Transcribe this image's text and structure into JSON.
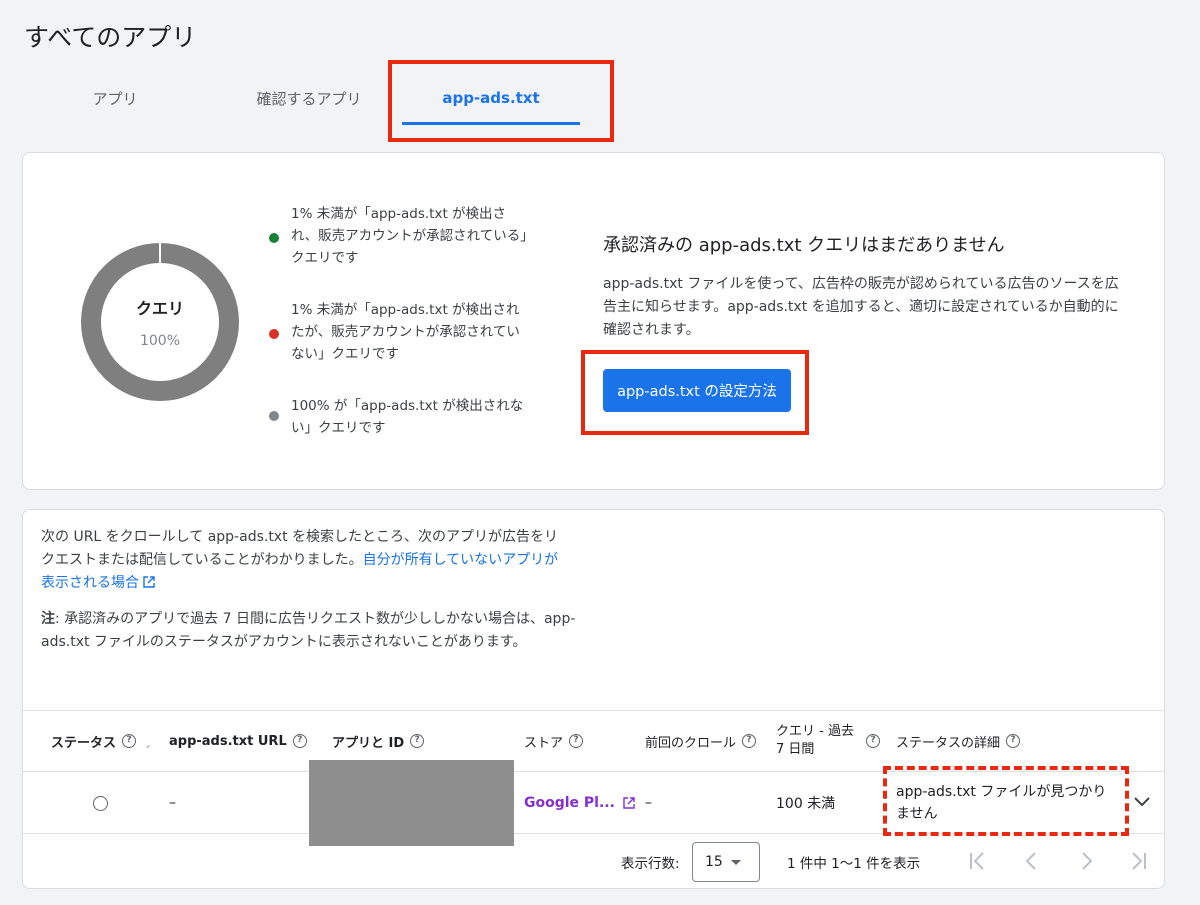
{
  "page": {
    "title": "すべてのアプリ"
  },
  "tabs": [
    {
      "label": "アプリ"
    },
    {
      "label": "確認するアプリ"
    },
    {
      "label": "app-ads.txt"
    }
  ],
  "summary": {
    "donut": {
      "label": "クエリ",
      "percent_text": "100%",
      "percent_value": 100
    },
    "legend": [
      {
        "text": "1% 未満が「app-ads.txt が検出され、販売アカウントが承認されている」クエリです",
        "color": "#188038"
      },
      {
        "text": "1% 未満が「app-ads.txt が検出されたが、販売アカウントが承認されていない」クエリです",
        "color": "#d93025"
      },
      {
        "text": "100% が「app-ads.txt が検出されない」クエリです",
        "color": "#80868b"
      }
    ],
    "info_title": "承認済みの app-ads.txt クエリはまだありません",
    "info_desc": "app-ads.txt ファイルを使って、広告枠の販売が認められている広告のソースを広告主に知らせます。app-ads.txt を追加すると、適切に設定されているか自動的に確認されます。",
    "setup_button": "app-ads.txt の設定方法"
  },
  "crawl": {
    "intro": "次の URL をクロールして app-ads.txt を検索したところ、次のアプリが広告をリクエストまたは配信していることがわかりました。",
    "intro_link": "自分が所有していないアプリが表示される場合",
    "note_label": "注",
    "note_text": ": 承認済みのアプリで過去 7 日間に広告リクエスト数が少ししかない場合は、app-ads.txt ファイルのステータスがアカウントに表示されないことがあります。"
  },
  "table": {
    "columns": {
      "status": "ステータス",
      "url": "app-ads.txt URL",
      "app": "アプリと ID",
      "store": "ストア",
      "last_crawl": "前回のクロール",
      "queries": "クエリ - 過去 7 日間",
      "details": "ステータスの詳細"
    },
    "rows": [
      {
        "url": "–",
        "store": "Google Pl...",
        "last_crawl": "–",
        "queries": "100 未満",
        "details": "app-ads.txt ファイルが見つかりません"
      }
    ]
  },
  "pagination": {
    "rows_label": "表示行数:",
    "rows_value": "15",
    "range": "1 件中 1〜1 件を表示"
  },
  "colors": {
    "accent": "#1a73e8",
    "highlight": "#e8280f",
    "store_link": "#8430ce"
  }
}
